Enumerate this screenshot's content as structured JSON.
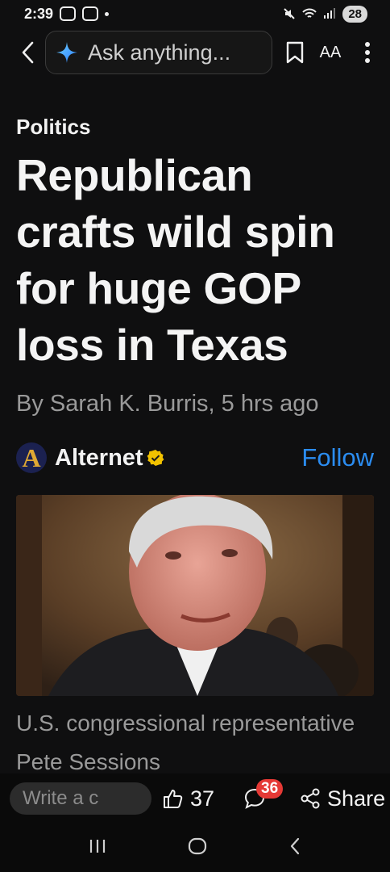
{
  "status_bar": {
    "time": "2:39",
    "battery": "28"
  },
  "toolbar": {
    "search_placeholder": "Ask anything...",
    "text_size_label": "AA"
  },
  "article": {
    "category": "Politics",
    "headline": "Republican crafts wild spin for huge GOP loss in Texas",
    "byline": "By Sarah K. Burris,  5 hrs ago",
    "source": {
      "name": "Alternet",
      "logo_letter": "A",
      "follow_label": "Follow"
    },
    "caption": "U.S. congressional representative Pete Sessions"
  },
  "action_bar": {
    "comment_placeholder": "Write a c",
    "likes": "37",
    "comments_count": "36",
    "share_label": "Share"
  },
  "colors": {
    "accent_link": "#2b8cf0",
    "badge": "#e53935",
    "background": "#0f0f10"
  }
}
